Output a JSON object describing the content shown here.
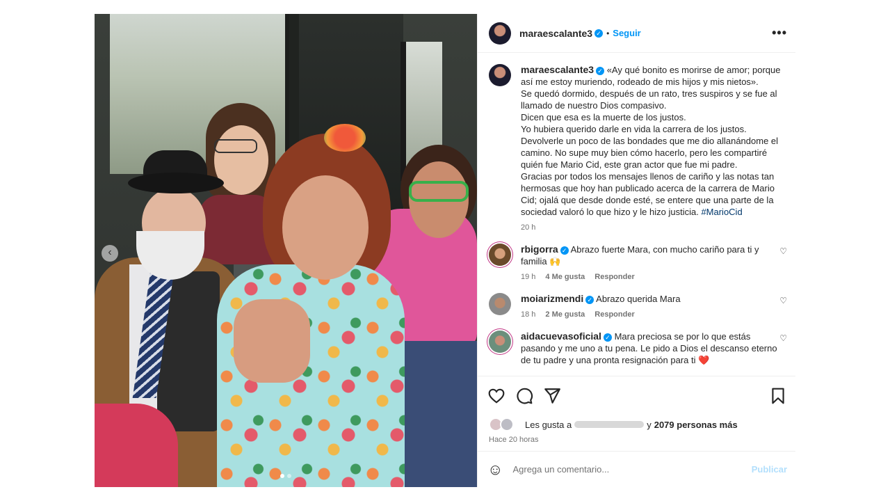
{
  "post": {
    "author": "maraescalante3",
    "follow_label": "Seguir",
    "separator": "•",
    "more_label": "•••",
    "caption_lines": [
      "«Ay qué bonito es morirse de amor; porque así me estoy muriendo, rodeado de mis hijos y mis nietos».",
      "Se quedó dormido, después de un rato, tres suspiros y se fue al llamado de nuestro Dios compasivo.",
      "Dicen que esa es la muerte de los justos.",
      "Yo hubiera querido darle en vida la carrera de los justos.",
      "Devolverle un poco de las bondades que me dio allanándome el camino. No supe muy bien cómo hacerlo, pero les compartiré quién fue Mario Cid, este gran actor que fue mi padre.",
      "Gracias por todos los mensajes llenos de cariño y las notas tan hermosas que hoy han publicado acerca de la carrera de Mario Cid; ojalá que desde donde esté, se entere que una parte de la sociedad valoró lo que hizo y le hizo justicia."
    ],
    "hashtag": "#MarioCid",
    "caption_time": "20 h"
  },
  "comments": [
    {
      "user": "rbigorra",
      "text": "Abrazo fuerte Mara, con mucho cariño para ti y familia 🙌",
      "time": "19 h",
      "likes": "4 Me gusta",
      "reply": "Responder",
      "heart": "♡"
    },
    {
      "user": "moiarizmendi",
      "text": "Abrazo querida Mara",
      "time": "18 h",
      "likes": "2 Me gusta",
      "reply": "Responder",
      "heart": "♡"
    },
    {
      "user": "aidacuevasoficial",
      "text": "Mara preciosa se por lo que estás pasando y me uno a tu pena. Le pido a Dios el descanso eterno de tu padre y una pronta resignación para ti ❤️",
      "heart": "♡"
    }
  ],
  "likes": {
    "prefix": "Les gusta a",
    "suffix": "y",
    "count_text": "2079 personas más"
  },
  "time_ago": "Hace 20 horas",
  "comment_box": {
    "placeholder": "Agrega un comentario...",
    "publish_label": "Publicar",
    "emoji_icon": "☺"
  },
  "carousel": {
    "prev_arrow": "‹",
    "slide_count": 2,
    "active_index": 0
  },
  "colors": {
    "link_blue": "#0095f6",
    "hashtag": "#00376b",
    "muted": "#737373"
  }
}
